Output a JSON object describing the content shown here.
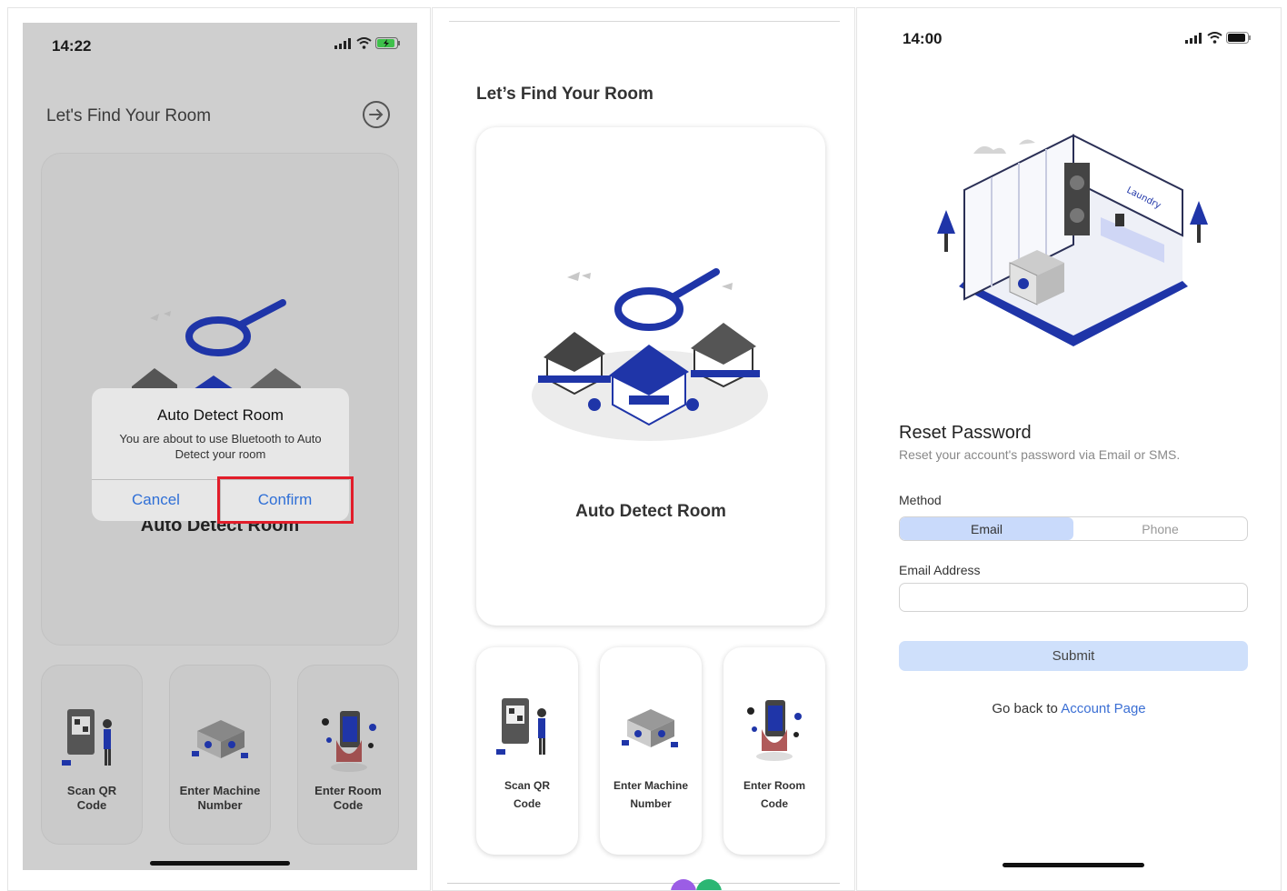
{
  "screens": [
    {
      "status": {
        "time": "14:22"
      },
      "header": {
        "title": "Let's Find Your Room",
        "next_icon": "arrow-right-circle-icon"
      },
      "main_card": {
        "label": "Auto Detect Room"
      },
      "dialog": {
        "title": "Auto Detect Room",
        "message": "You are about to use Bluetooth to Auto Detect your room",
        "cancel_label": "Cancel",
        "confirm_label": "Confirm"
      },
      "options": [
        {
          "line1": "Scan QR",
          "line2": "Code"
        },
        {
          "line1": "Enter Machine",
          "line2": "Number"
        },
        {
          "line1": "Enter Room",
          "line2": "Code"
        }
      ]
    },
    {
      "header": {
        "title": "Let’s Find Your Room"
      },
      "main_card": {
        "label": "Auto Detect Room"
      },
      "options": [
        {
          "line1": "Scan QR",
          "line2": "Code"
        },
        {
          "line1": "Enter Machine",
          "line2": "Number"
        },
        {
          "line1": "Enter Room",
          "line2": "Code"
        }
      ]
    },
    {
      "status": {
        "time": "14:00"
      },
      "title": "Reset Password",
      "subtitle": "Reset your account's password via Email or SMS.",
      "method_label": "Method",
      "methods": [
        "Email",
        "Phone"
      ],
      "selected_method": "Email",
      "email_label": "Email Address",
      "email_value": "",
      "email_placeholder": "",
      "submit_label": "Submit",
      "back_prefix": "Go back to",
      "back_link": "Account Page",
      "illustration_text": "Laundry"
    }
  ],
  "colors": {
    "brand_blue": "#1f35a8",
    "accent_link": "#3b6fd4",
    "highlight_red": "#e21d2a",
    "segment_active": "#c9dafb",
    "submit_bg": "#cfe0fb",
    "overlay_gray": "#cfcfcf"
  }
}
